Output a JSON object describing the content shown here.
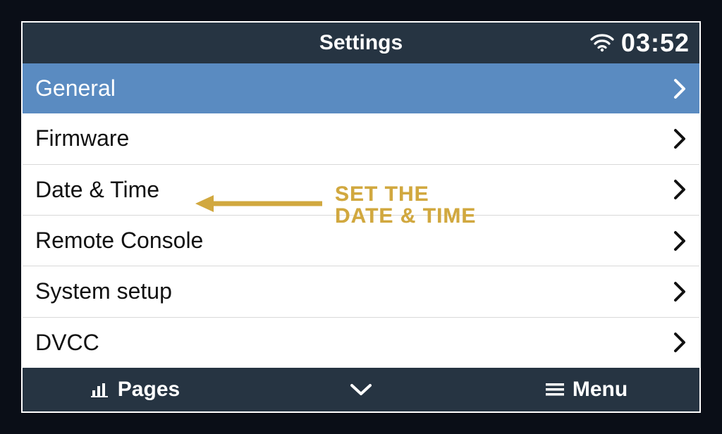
{
  "header": {
    "title": "Settings",
    "time": "03:52"
  },
  "rows": [
    {
      "label": "General",
      "selected": true
    },
    {
      "label": "Firmware",
      "selected": false
    },
    {
      "label": "Date & Time",
      "selected": false
    },
    {
      "label": "Remote Console",
      "selected": false
    },
    {
      "label": "System setup",
      "selected": false
    },
    {
      "label": "DVCC",
      "selected": false
    }
  ],
  "footer": {
    "pages": "Pages",
    "menu": "Menu"
  },
  "annotation": {
    "line1": "Set the",
    "line2": "date & time"
  }
}
